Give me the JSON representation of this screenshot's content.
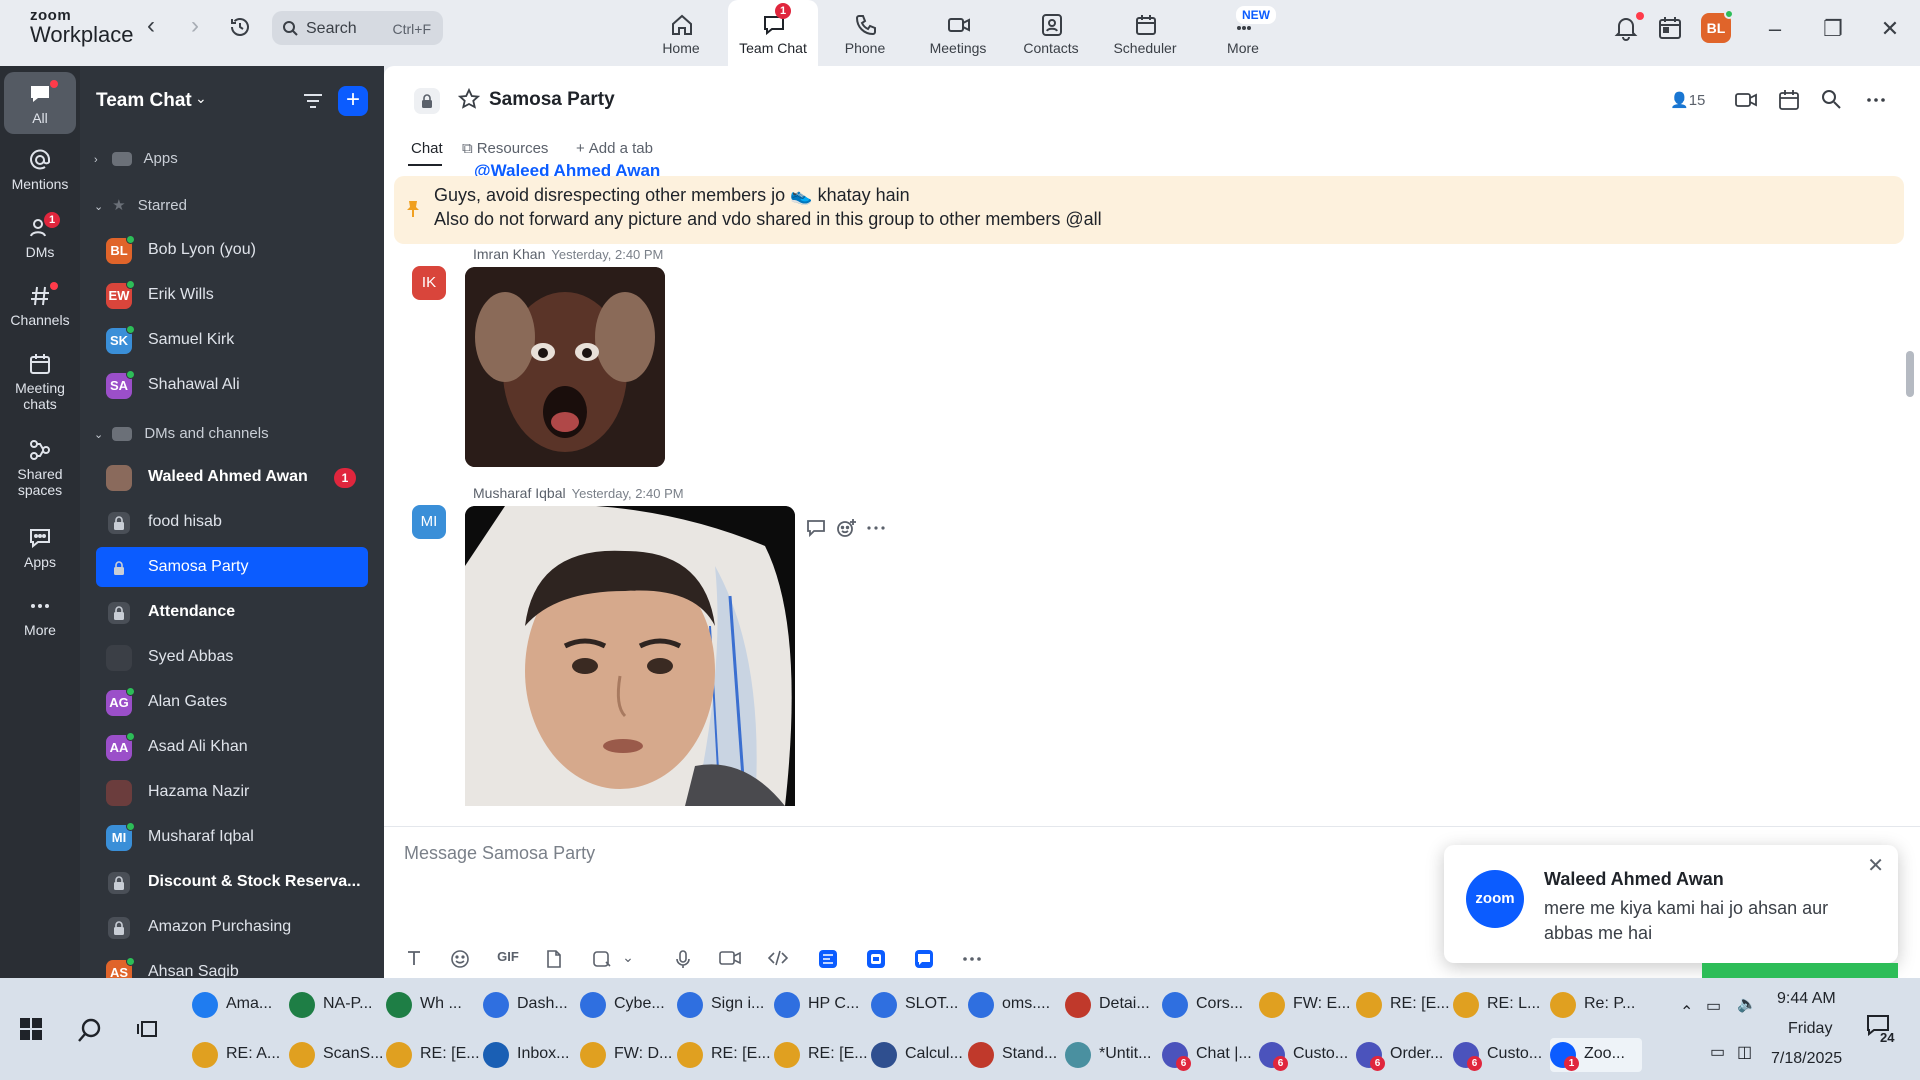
{
  "app": {
    "logo_line1": "zoom",
    "logo_line2": "Workplace",
    "search_label": "Search",
    "search_shortcut": "Ctrl+F",
    "profile_initials": "BL"
  },
  "top_tabs": [
    {
      "label": "Home",
      "icon": "home-icon"
    },
    {
      "label": "Team Chat",
      "icon": "chat-icon",
      "badge": "1"
    },
    {
      "label": "Phone",
      "icon": "phone-icon"
    },
    {
      "label": "Meetings",
      "icon": "video-icon"
    },
    {
      "label": "Contacts",
      "icon": "contacts-icon"
    },
    {
      "label": "Scheduler",
      "icon": "calendar-icon"
    },
    {
      "label": "More",
      "icon": "more-icon",
      "tag": "NEW"
    }
  ],
  "rail": [
    {
      "label": "All",
      "icon": "chat-bubble-icon"
    },
    {
      "label": "Mentions",
      "icon": "at-icon"
    },
    {
      "label": "DMs",
      "icon": "person-icon",
      "badge": "1"
    },
    {
      "label": "Channels",
      "icon": "hash-icon"
    },
    {
      "label": "Meeting chats",
      "icon": "calendar-icon"
    },
    {
      "label": "Shared spaces",
      "icon": "share-icon"
    },
    {
      "label": "Apps",
      "icon": "apps-icon"
    },
    {
      "label": "More",
      "icon": "ellipsis-icon"
    }
  ],
  "sidebar": {
    "title": "Team Chat",
    "apps_label": "Apps",
    "starred_label": "Starred",
    "starred": [
      {
        "name": "Bob Lyon (you)",
        "initials": "BL",
        "color": "#e0642a"
      },
      {
        "name": "Erik Wills",
        "initials": "EW",
        "color": "#d9453b"
      },
      {
        "name": "Samuel Kirk",
        "initials": "SK",
        "color": "#3a8fd8"
      },
      {
        "name": "Shahawal Ali",
        "initials": "SA",
        "color": "#9b4fc9"
      }
    ],
    "dms_label": "DMs and channels",
    "dms": [
      {
        "name": "Waleed Ahmed Awan",
        "initials": "",
        "color": "#8a6a5c",
        "count": "1",
        "bold": true
      },
      {
        "name": "food hisab",
        "lock": true
      },
      {
        "name": "Samosa Party",
        "lock": true,
        "selected": true
      },
      {
        "name": "Attendance",
        "lock": true,
        "bold": true
      },
      {
        "name": "Syed Abbas",
        "initials": "",
        "color": "#3b3f46"
      },
      {
        "name": "Alan Gates",
        "initials": "AG",
        "color": "#9b4fc9"
      },
      {
        "name": "Asad Ali Khan",
        "initials": "AA",
        "color": "#9b4fc9"
      },
      {
        "name": "Hazama Nazir",
        "initials": "",
        "color": "#6b3d3d"
      },
      {
        "name": "Musharaf Iqbal",
        "initials": "MI",
        "color": "#3a8fd8"
      },
      {
        "name": "Discount & Stock Reserva...",
        "lock": true,
        "bold": true
      },
      {
        "name": "Amazon Purchasing",
        "lock": true
      },
      {
        "name": "Ahsan Saqib",
        "initials": "AS",
        "color": "#e0642a"
      }
    ]
  },
  "channel": {
    "name": "Samosa Party",
    "members": "15",
    "tabs": [
      "Chat",
      "Resources",
      "Add a tab"
    ],
    "pinned_line1": "Guys, avoid disrespecting other members jo 👟 khatay hain",
    "pinned_line2": "Also do not forward any picture and vdo shared in this group to other members @all",
    "peek_text": "@Waleed Ahmed Awan",
    "messages": [
      {
        "author": "Imran Khan",
        "time": "Yesterday, 2:40 PM",
        "initials": "IK",
        "color": "#d9453b"
      },
      {
        "author": "Musharaf Iqbal",
        "time": "Yesterday, 2:40 PM",
        "initials": "MI",
        "color": "#3a8fd8"
      }
    ],
    "composer_placeholder": "Message Samosa Party",
    "gif_label": "GIF"
  },
  "toast": {
    "logo_text": "zoom",
    "title": "Waleed Ahmed Awan",
    "body": "mere me kiya kami hai jo ahsan aur abbas me hai"
  },
  "taskbar": {
    "row1": [
      "Ama...",
      "NA-P...",
      "Wh ...",
      "Dash...",
      "Cybe...",
      "Sign i...",
      "HP C...",
      "SLOT...",
      "oms....",
      "Detai...",
      "Cors...",
      "FW: E...",
      "RE: [E...",
      "RE: L...",
      "Re: P..."
    ],
    "row2": [
      "RE: A...",
      "ScanS...",
      "RE: [E...",
      "Inbox...",
      "FW: D...",
      "RE: [E...",
      "RE: [E...",
      "Calcul...",
      "Stand...",
      "*Untit...",
      "Chat |...",
      "Custo...",
      "Order...",
      "Custo...",
      "Zoo..."
    ],
    "row2_badges": [
      "",
      "",
      "",
      "",
      "",
      "",
      "",
      "",
      "",
      "",
      "6",
      "6",
      "6",
      "6",
      "1"
    ],
    "time": "9:44 AM",
    "day": "Friday",
    "date": "7/18/2025",
    "notif_count": "24"
  },
  "colors": {
    "accent": "#0b5cff",
    "sidebar_bg": "#2f343b",
    "rail_bg": "#2a2e34",
    "badge": "#e0263d",
    "pinned_bg": "#fdf1dd"
  }
}
